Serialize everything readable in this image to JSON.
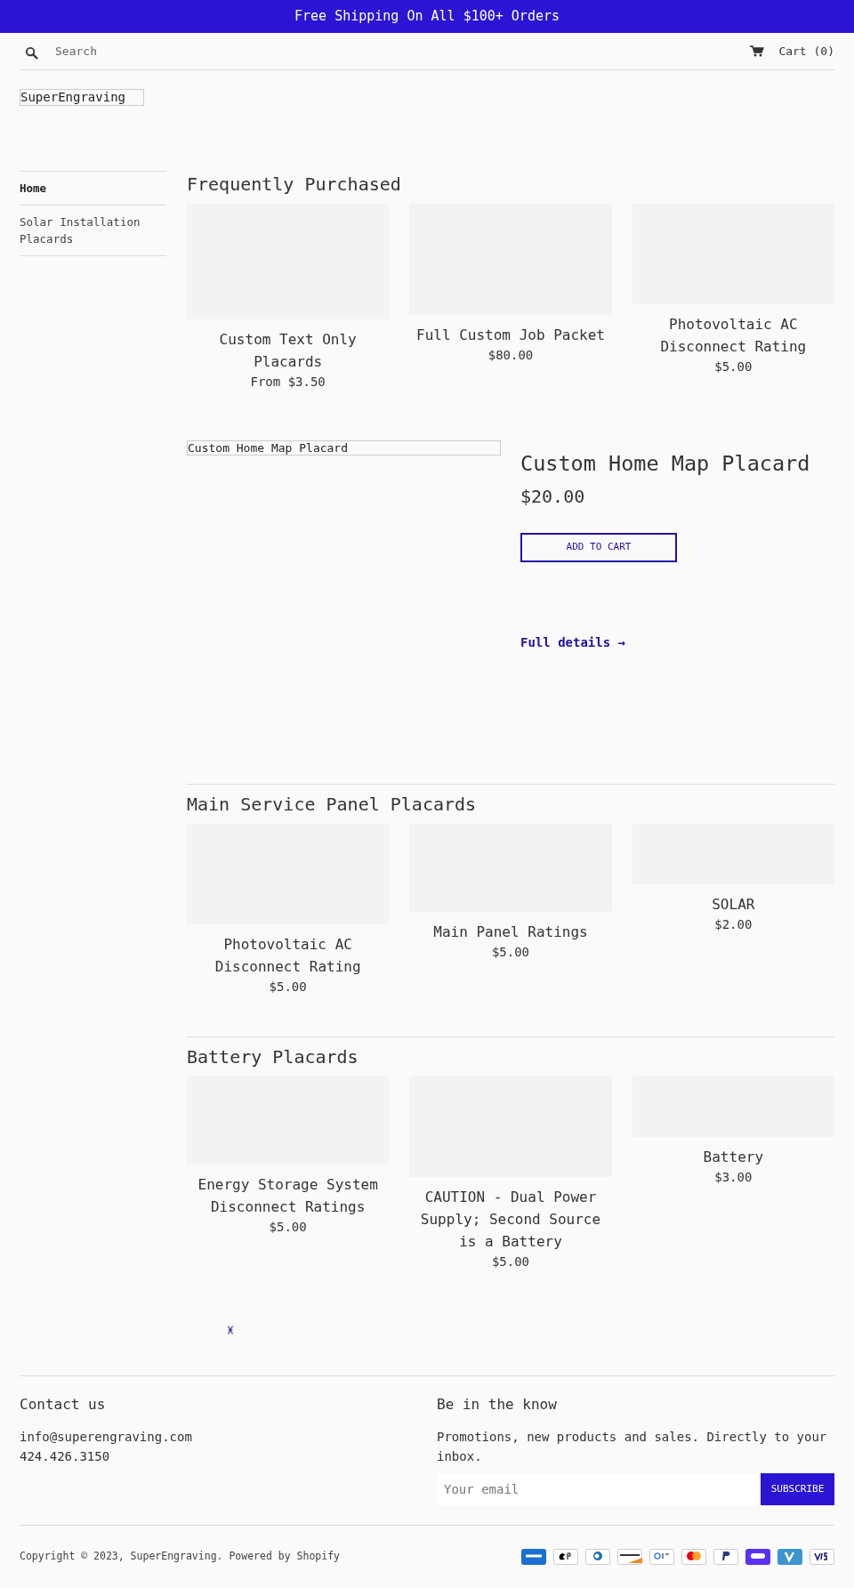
{
  "announcement": "Free Shipping On All $100+ Orders",
  "header": {
    "search": {
      "placeholder": "Search"
    },
    "cart": "Cart (0)"
  },
  "logo": "SuperEngraving",
  "sidebar": {
    "items": [
      {
        "label": "Home",
        "selected": true
      },
      {
        "label": "Solar Installation Placards",
        "selected": false
      }
    ]
  },
  "sections": [
    {
      "kind": "collection",
      "title": "Frequently Purchased",
      "divider": false,
      "products": [
        {
          "title": "Custom Text Only Placards",
          "price": "From $3.50"
        },
        {
          "title": "Full Custom Job Packet",
          "price": "$80.00"
        },
        {
          "title": "Photovoltaic AC Disconnect Rating",
          "price": "$5.00"
        }
      ]
    },
    {
      "kind": "featured",
      "image_alt": "Custom Home Map Placard",
      "title": "Custom Home Map Placard",
      "price": "$20.00",
      "button": "ADD TO CART",
      "link": "Full details →"
    },
    {
      "kind": "collection",
      "title": "Main Service Panel Placards",
      "divider": true,
      "products": [
        {
          "title": "Photovoltaic AC Disconnect Rating",
          "price": "$5.00"
        },
        {
          "title": "Main Panel Ratings",
          "price": "$5.00"
        },
        {
          "title": "SOLAR",
          "price": "$2.00"
        }
      ]
    },
    {
      "kind": "collection",
      "title": "Battery Placards",
      "divider": true,
      "products": [
        {
          "title": "Energy Storage System Disconnect Ratings",
          "price": "$5.00"
        },
        {
          "title": "CAUTION - Dual Power Supply; Second Source is a Battery",
          "price": "$5.00"
        },
        {
          "title": "Battery",
          "price": "$3.00"
        }
      ]
    }
  ],
  "footer": {
    "contact": {
      "title": "Contact us",
      "lines": [
        "info@superengraving.com",
        "424.426.3150"
      ]
    },
    "newsletter": {
      "title": "Be in the know",
      "text": "Promotions, new products and sales. Directly to your inbox.",
      "placeholder": "Your email",
      "button": "SUBSCRIBE"
    },
    "copyright": "Copyright © 2023, SuperEngraving. Powered by Shopify"
  }
}
